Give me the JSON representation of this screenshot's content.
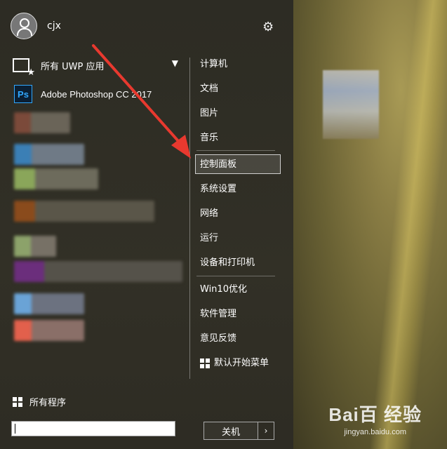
{
  "user": {
    "name": "cjx"
  },
  "left": {
    "uwp_label": "所有 UWP 应用",
    "pinned_app": {
      "label": "Adobe Photoshop CC 2017",
      "icon": "Ps"
    },
    "all_programs": "所有程序"
  },
  "right": {
    "items": [
      "计算机",
      "文档",
      "图片",
      "音乐",
      "控制面板",
      "系统设置",
      "网络",
      "运行",
      "设备和打印机",
      "Win10优化",
      "软件管理",
      "意见反馈",
      "默认开始菜单"
    ],
    "selected": "控制面板"
  },
  "footer": {
    "shutdown_label": "关机",
    "arrow": "›"
  },
  "watermark": {
    "logo": "Bai百 经验",
    "url": "jingyan.baidu.com"
  },
  "colors": {
    "accent_arrow": "#e8392f",
    "ps_blue": "#31a8ff"
  }
}
